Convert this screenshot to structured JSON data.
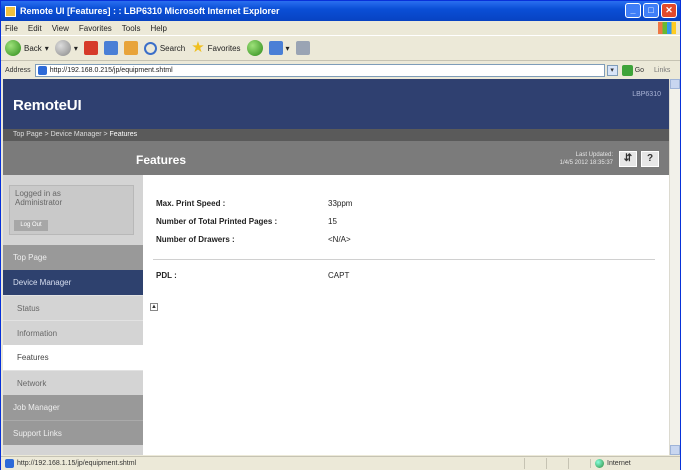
{
  "window": {
    "title": "Remote UI [Features] : : LBP6310   Microsoft Internet Explorer"
  },
  "menu": [
    "File",
    "Edit",
    "View",
    "Favorites",
    "Tools",
    "Help"
  ],
  "toolbar": {
    "back": "Back",
    "search": "Search",
    "favorites": "Favorites"
  },
  "address": {
    "label": "Address",
    "url": "http://192.168.0.215/jp/equipment.shtml",
    "go": "Go",
    "links": "Links"
  },
  "remoteui": {
    "brand": "RemoteUI",
    "device": "LBP6310",
    "breadcrumb": {
      "top": "Top Page",
      "sep1": " > ",
      "device": "Device Manager",
      "sep2": " > ",
      "current": "Features"
    },
    "page_title": "Features",
    "last_updated_label": "Last Updated:",
    "last_updated_value": "1/4/5 2012 18:35:37",
    "refresh_icon": "refresh-icon",
    "help_label": "?"
  },
  "sidebar": {
    "login_text": "Logged in as Administrator",
    "logout": "Log Out",
    "items": [
      {
        "label": "Top Page"
      },
      {
        "label": "Device Manager"
      },
      {
        "label": "Status"
      },
      {
        "label": "Information"
      },
      {
        "label": "Features"
      },
      {
        "label": "Network"
      },
      {
        "label": "Job Manager"
      },
      {
        "label": "Support Links"
      }
    ]
  },
  "features": [
    {
      "label": "Max. Print Speed :",
      "value": "33ppm"
    },
    {
      "label": "Number of Total Printed Pages :",
      "value": "15"
    },
    {
      "label": "Number of Drawers :",
      "value": "<N/A>"
    },
    {
      "label": "PDL :",
      "value": "CAPT"
    }
  ],
  "status": {
    "url": "http://192.168.1.15/jp/equipment.shtml",
    "zone": "Internet"
  }
}
